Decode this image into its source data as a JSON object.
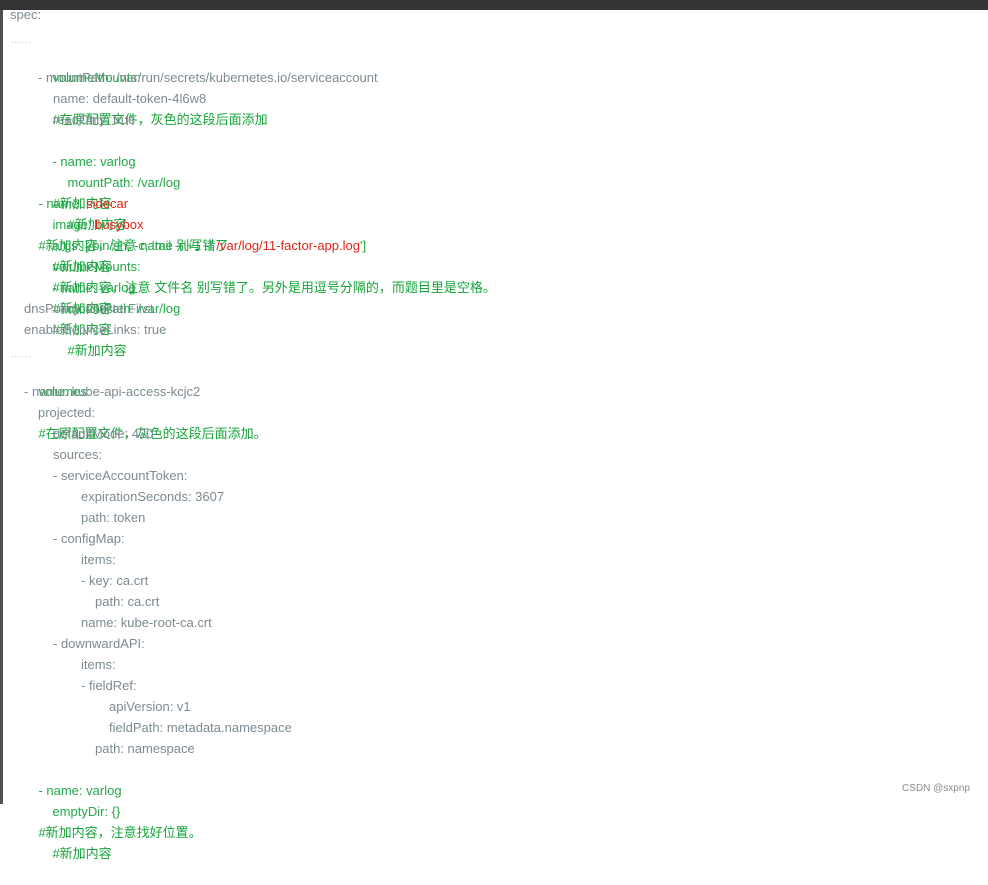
{
  "doc": {
    "spec": "spec:",
    "dots": "......",
    "volumeMounts_main": "volumeMounts:",
    "volumeMounts_main_comment": "#在原配置文件，灰色的这段后面添加",
    "mountPath_sa": "- mountPath: /var/run/secrets/kubernetes.io/serviceaccount",
    "name_default_token": "name: default-token-4l6w8",
    "readOnly": "readOnly: true",
    "name_varlog_1_prefix": "- name: varlog",
    "comment_add": "#新加内容",
    "mountPath_varlog_1": "mountPath: /var/log",
    "sidecar_prefix": "- name: ",
    "sidecar_value": "sidecar",
    "sidecar_comment": "#新加内容，注意 name 别写错了",
    "image_prefix": "image: ",
    "image_value": "busybox",
    "args_prefix": "args: [/bin/sh, -c, 'tail -n+1 -f ",
    "args_value": "/var/log/11-factor-app.log",
    "args_suffix": "']",
    "args_comment": "#新加内容，注意 文件名 别写错了。另外是用逗号分隔的，而题目里是空格。",
    "volumeMounts_sidecar": "volumeMounts:",
    "name_varlog_2": "- name: varlog",
    "mountPath_varlog_2": "mountPath: /var/log",
    "dnsPolicy": "dnsPolicy: ClusterFirst",
    "enableServiceLinks": "enableServiceLinks: true",
    "volumes": "volumes:",
    "volumes_comment": "#在原配置文件，灰色的这段后面添加。",
    "kube_api_access": "- name: kube-api-access-kcjc2",
    "projected": "projected:",
    "defaultMode": "defaultMode: 420",
    "sources": "sources:",
    "serviceAccountToken": "- serviceAccountToken:",
    "expirationSeconds": "expirationSeconds: 3607",
    "path_token": "path: token",
    "configMap": "- configMap:",
    "items_1": "items:",
    "key_ca": "- key: ca.crt",
    "path_ca": "path: ca.crt",
    "name_root_ca": "name: kube-root-ca.crt",
    "downwardAPI": "- downwardAPI:",
    "items_2": "items:",
    "fieldRef": "- fieldRef:",
    "apiVersion": "apiVersion: v1",
    "fieldPath": "fieldPath: metadata.namespace",
    "path_namespace": "path: namespace",
    "varlog_volume": "- name: varlog",
    "varlog_volume_comment": "#新加内容，注意找好位置。",
    "emptyDir": "emptyDir: {}",
    "emptyDir_comment": "#新加内容"
  },
  "watermark": "CSDN @sxpnp",
  "colors": {
    "key": "#7c8a92",
    "green": "#22a84a",
    "red": "#e0241a",
    "comment": "#16a53a"
  }
}
